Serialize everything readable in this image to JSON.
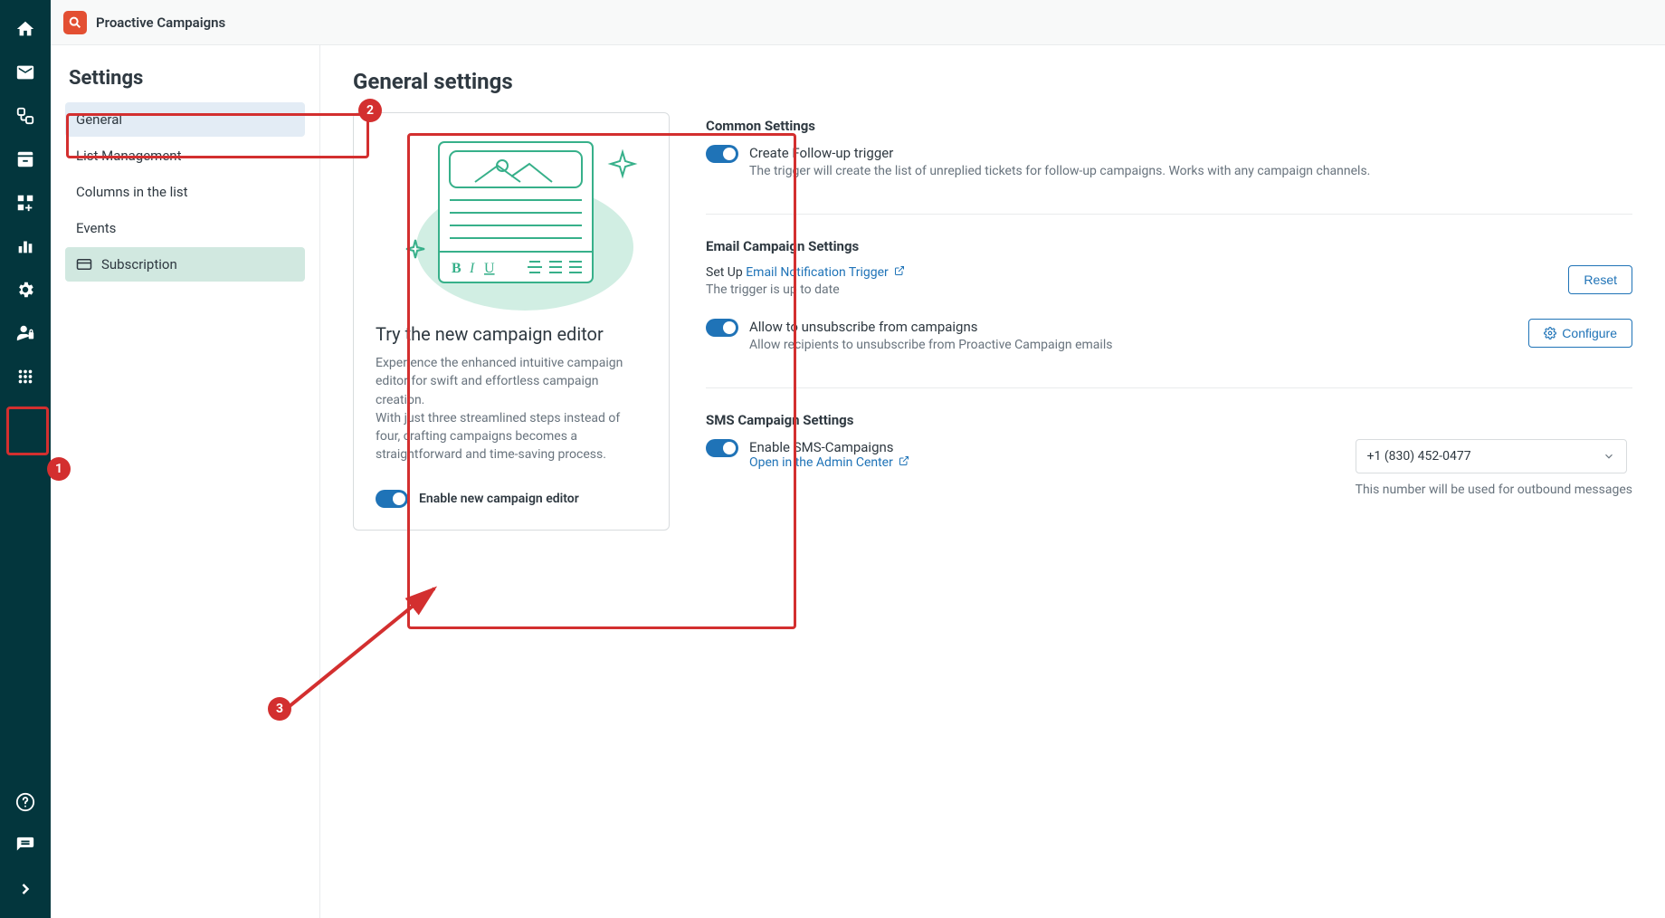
{
  "app": {
    "title": "Proactive Campaigns"
  },
  "settings_sidebar": {
    "title": "Settings",
    "items": [
      {
        "label": "General"
      },
      {
        "label": "List Management"
      },
      {
        "label": "Columns in the list"
      },
      {
        "label": "Events"
      },
      {
        "label": "Subscription"
      }
    ]
  },
  "content": {
    "title": "General settings",
    "promo": {
      "title": "Try the new campaign editor",
      "desc1": "Experience the enhanced intuitive campaign editor for swift and effortless campaign creation.",
      "desc2": "With just three streamlined steps instead of four, crafting campaigns becomes a straightforward and time-saving process.",
      "toggle_label": "Enable new campaign editor"
    },
    "common": {
      "title": "Common Settings",
      "follow_label": "Create Follow-up trigger",
      "follow_desc": "The trigger will create the list of unreplied tickets for follow-up campaigns. Works with any campaign channels."
    },
    "email": {
      "title": "Email Campaign Settings",
      "setup_prefix": "Set Up ",
      "setup_link": "Email Notification Trigger",
      "setup_status": "The trigger is up to date",
      "reset": "Reset",
      "unsub_label": "Allow to unsubscribe from campaigns",
      "unsub_desc": "Allow recipients to unsubscribe from Proactive Campaign emails",
      "configure": "Configure"
    },
    "sms": {
      "title": "SMS Campaign Settings",
      "enable_label": "Enable SMS-Campaigns",
      "admin_link": "Open in the Admin Center",
      "phone": "+1 (830) 452-0477",
      "hint": "This number will be used for outbound messages"
    }
  },
  "annotations": {
    "n1": "1",
    "n2": "2",
    "n3": "3"
  }
}
